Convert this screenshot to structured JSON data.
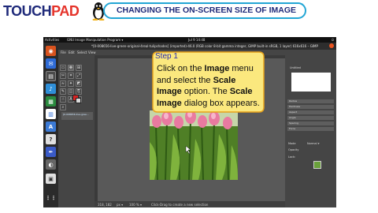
{
  "header": {
    "logo_a": "TOUCH",
    "logo_b": "PAD",
    "title": "CHANGING THE ON-SCREEN SIZE OF IMAGE"
  },
  "topbar": {
    "activities": "Activities",
    "app": "GNU Image Manipulation Program ▾",
    "clock": "Jul 9  14:48",
    "system": "⏻"
  },
  "window": {
    "title": "*[0-008656-live-green-original-4real-tulipshades] (imported)-46.0 (RGB color 8-bit gamma integer, GIMP built-in sRGB, 1 layer) 616x616 – GIMP"
  },
  "menu": {
    "items": [
      "File",
      "Edit",
      "Select",
      "View"
    ]
  },
  "image_tab": "[0-008656-live-gree...",
  "status": {
    "coords": "318, 182",
    "unit": "px ▾",
    "zoom": "100 % ▾",
    "message": "Click-Drag to create a new selection"
  },
  "dock_panel": {
    "untitled": "Untitled",
    "rows": [
      "Radius",
      "Hardness",
      "Aspect",
      "Angle",
      "Spacing",
      "Force"
    ],
    "mode_label": "Mode",
    "mode_value": "Normal ▾",
    "opacity_label": "Opacity",
    "lock_label": "Lock:"
  },
  "callout": {
    "step": "Step 1",
    "t1": "Click on the ",
    "b1": "Image",
    "t2": " menu and select the ",
    "b2": "Scale Image",
    "t3": " option. The ",
    "b3": "Scale Image",
    "t4": " dialog box appears."
  },
  "colors": {
    "accent_blue": "#23a6d5",
    "brand_navy": "#1f2a7a",
    "brand_red": "#e5332a",
    "callout_fill": "#fbe87e",
    "callout_border": "#e8a21a"
  }
}
